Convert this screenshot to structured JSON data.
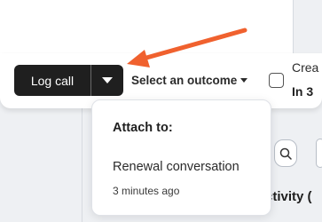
{
  "toolbar": {
    "log_call_label": "Log call",
    "outcome_label": "Select an outcome",
    "create_label": "Crea",
    "in3_label": "In 3"
  },
  "popover": {
    "title": "Attach to:",
    "item_label": "Renewal conversation",
    "item_time": "3 minutes ago"
  },
  "background": {
    "activity_heading": "ctivity ("
  },
  "icons": {
    "split_button": "caret-down-icon",
    "outcome": "caret-down-icon",
    "search": "search-icon",
    "annotation": "arrow-icon"
  },
  "colors": {
    "primary_button": "#1f1f1f",
    "annotation_arrow": "#f0612e",
    "page_background": "#eef0f3",
    "surface": "#ffffff"
  }
}
